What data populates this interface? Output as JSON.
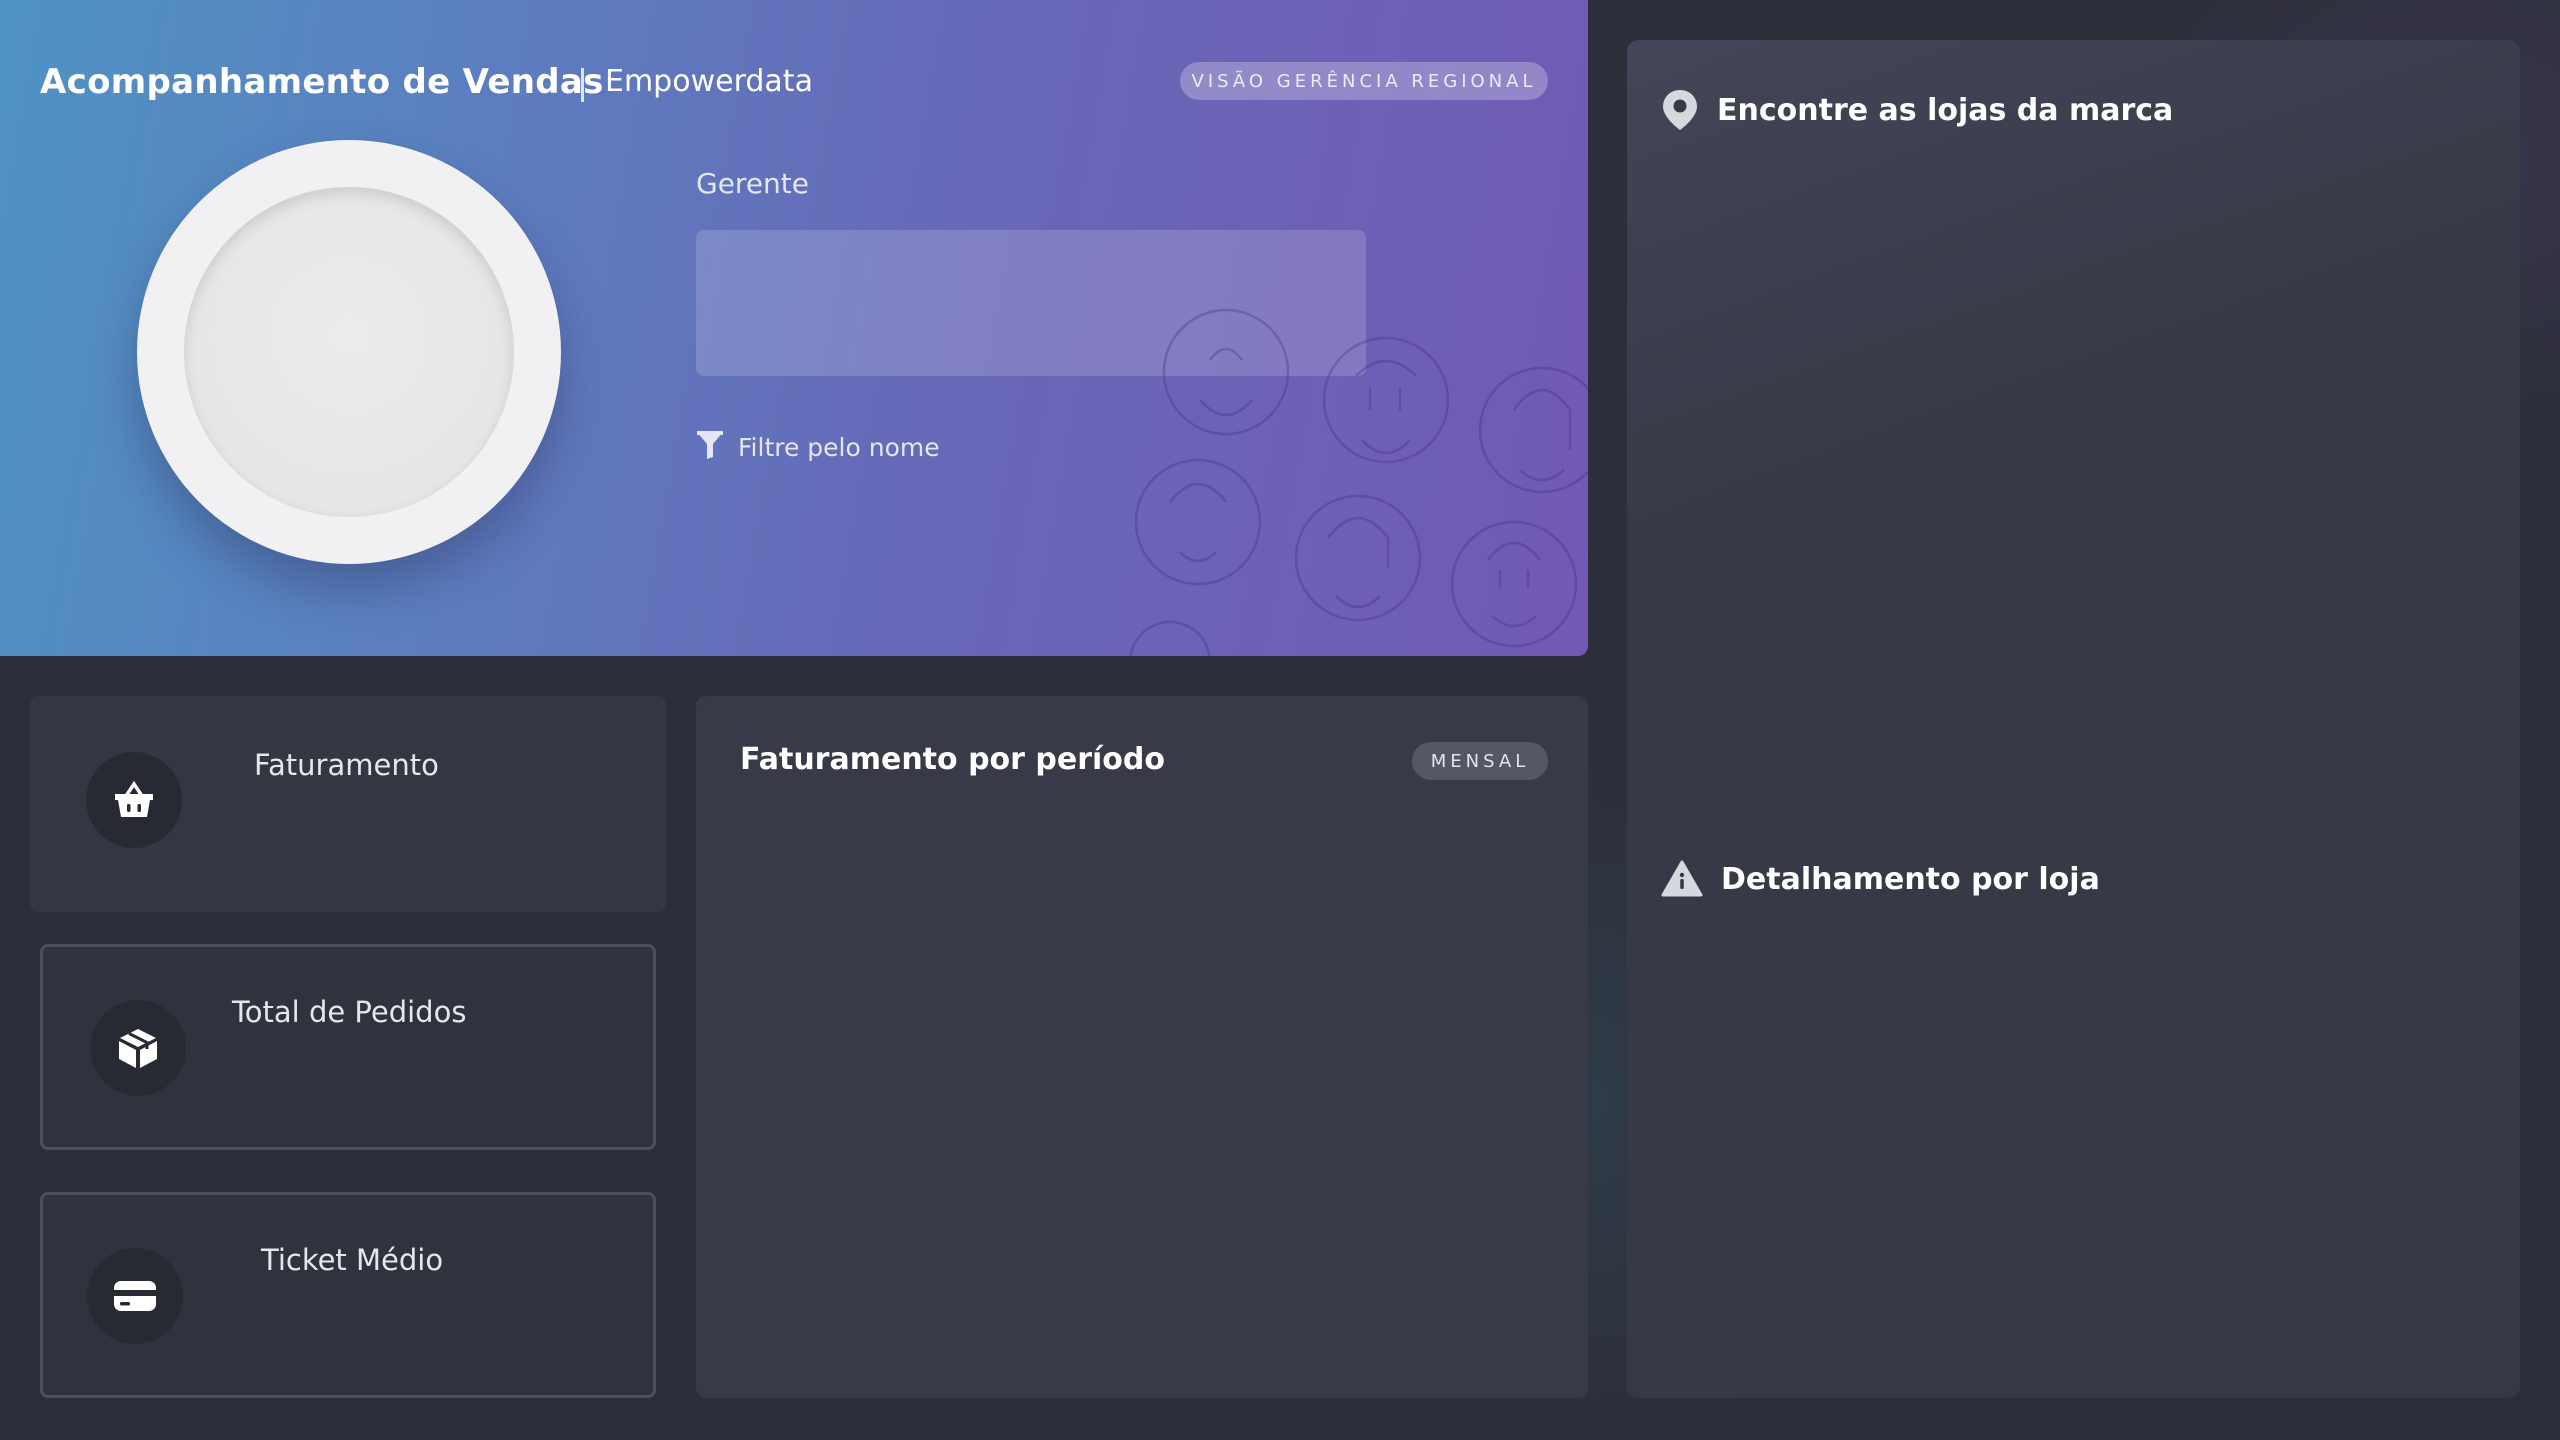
{
  "header": {
    "title": "Acompanhamento de Vendas",
    "brand": "Empowerdata",
    "badge": "VISÃO GERÊNCIA REGIONAL",
    "manager_label": "Gerente",
    "filter_text": "Filtre pelo nome",
    "gradient_colors": [
      "#4f93c4",
      "#7159b4"
    ]
  },
  "kpis": [
    {
      "label": "Faturamento",
      "icon": "basket-icon"
    },
    {
      "label": "Total de Pedidos",
      "icon": "box-icon"
    },
    {
      "label": "Ticket Médio",
      "icon": "credit-card-icon"
    }
  ],
  "revenue_panel": {
    "title": "Faturamento por período",
    "period_badge": "MENSAL"
  },
  "right_panel": {
    "stores_title": "Encontre as lojas da marca",
    "stores_icon": "map-pin-icon",
    "detail_title": "Detalhamento por loja",
    "detail_icon": "warning-icon"
  }
}
